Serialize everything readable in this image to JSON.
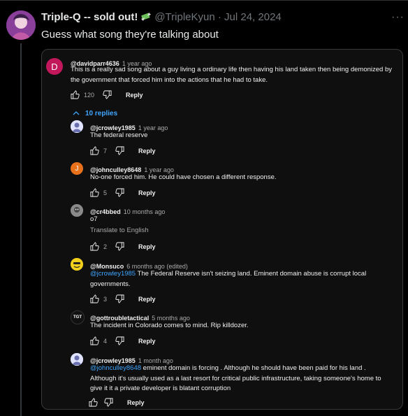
{
  "tweet": {
    "display_name": "Triple-Q -- sold out!",
    "handle_time": "@TripleKyun · Jul 24, 2024",
    "text": "Guess what song they're talking about",
    "more": "···"
  },
  "top_comment": {
    "avatar_letter": "D",
    "author": "@davidparr4636",
    "time": "1 year ago",
    "text": "This is a really sad song about a guy living a ordinary life then having his land taken then being demonized by the government that forced him into the actions that he had to take.",
    "likes": "120",
    "reply_label": "Reply",
    "replies_toggle": "10 replies"
  },
  "replies": [
    {
      "author": "@jcrowley1985",
      "time": "1 year ago",
      "text": "The federal reserve",
      "likes": "7",
      "reply_label": "Reply"
    },
    {
      "author": "@johnculley8648",
      "time": "1 year ago",
      "avatar_letter": "J",
      "text": "No-one forced him. He could have chosen a different response.",
      "likes": "5",
      "reply_label": "Reply"
    },
    {
      "author": "@cr4bbed",
      "time": "10 months ago",
      "text": "o7",
      "translate": "Translate to English",
      "likes": "2",
      "reply_label": "Reply"
    },
    {
      "author": "@Monsuco",
      "time": "6 months ago (edited)",
      "mention": "@jcrowley1985",
      "text": " The Federal Reserve isn't seizing land. Eminent domain abuse is corrupt local governments.",
      "likes": "3",
      "reply_label": "Reply"
    },
    {
      "author": "@gottroubletactical",
      "time": "5 months ago",
      "avatar_text": "TGT",
      "text": "The incident in Colorado comes to mind. Rip killdozer.",
      "likes": "4",
      "reply_label": "Reply"
    },
    {
      "author": "@jcrowley1985",
      "time": "1 month ago",
      "mention": "@johnculley8648",
      "text": " eminent domain is forcing .  Although he should have been paid for his land . Although it's usually used as a last resort for critical  public infrastructure, taking someone's home to give it it a private developer is blatant corruption",
      "likes": "",
      "reply_label": "Reply"
    }
  ]
}
